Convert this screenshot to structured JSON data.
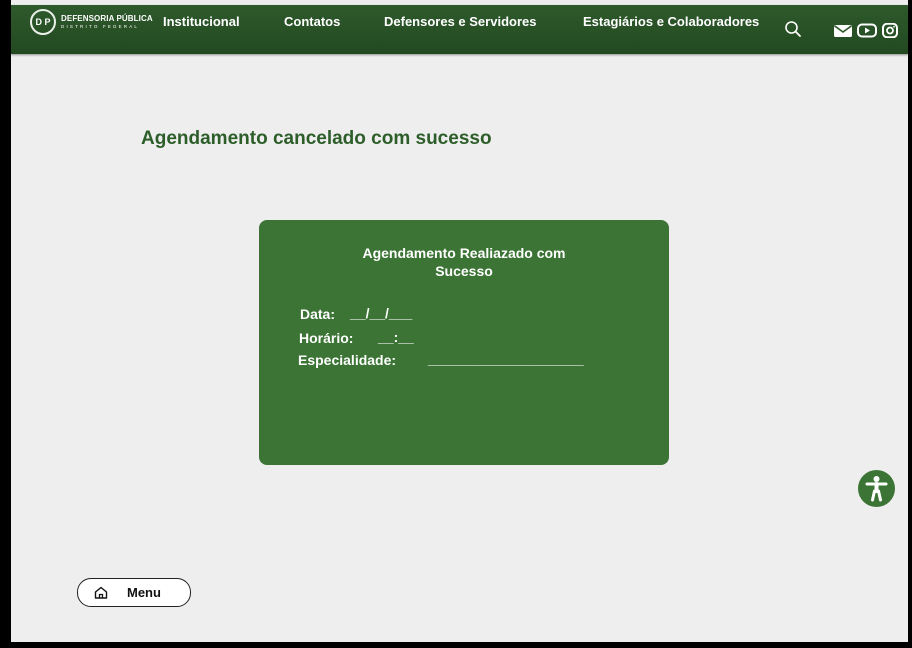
{
  "header": {
    "logo": {
      "seal_text": "D P",
      "line1": "DEFENSORIA PÚBLICA",
      "line2": "DISTRITO FEDERAL"
    },
    "nav": [
      {
        "label": "Institucional"
      },
      {
        "label": "Contatos"
      },
      {
        "label": "Defensores e Servidores"
      },
      {
        "label": "Estagiários e Colaboradores"
      }
    ],
    "icons": [
      "search-icon",
      "mail-icon",
      "youtube-icon",
      "instagram-icon"
    ]
  },
  "main": {
    "title": "Agendamento cancelado com sucesso",
    "card": {
      "title_line1": "Agendamento Realiazado com",
      "title_line2": "Sucesso",
      "fields": [
        {
          "label": "Data:",
          "value": "__/__/___"
        },
        {
          "label": "Horário:",
          "value": "__:__"
        },
        {
          "label": "Especialidade:",
          "value": "____________________"
        }
      ]
    }
  },
  "accessibility_button": {
    "icon": "accessibility-icon"
  },
  "menu_button": {
    "label": "Menu",
    "icon": "home-icon"
  },
  "colors": {
    "header": "#2e5a2c",
    "accent": "#3b7434",
    "title": "#2d5e2a",
    "background": "#eeeeee"
  }
}
